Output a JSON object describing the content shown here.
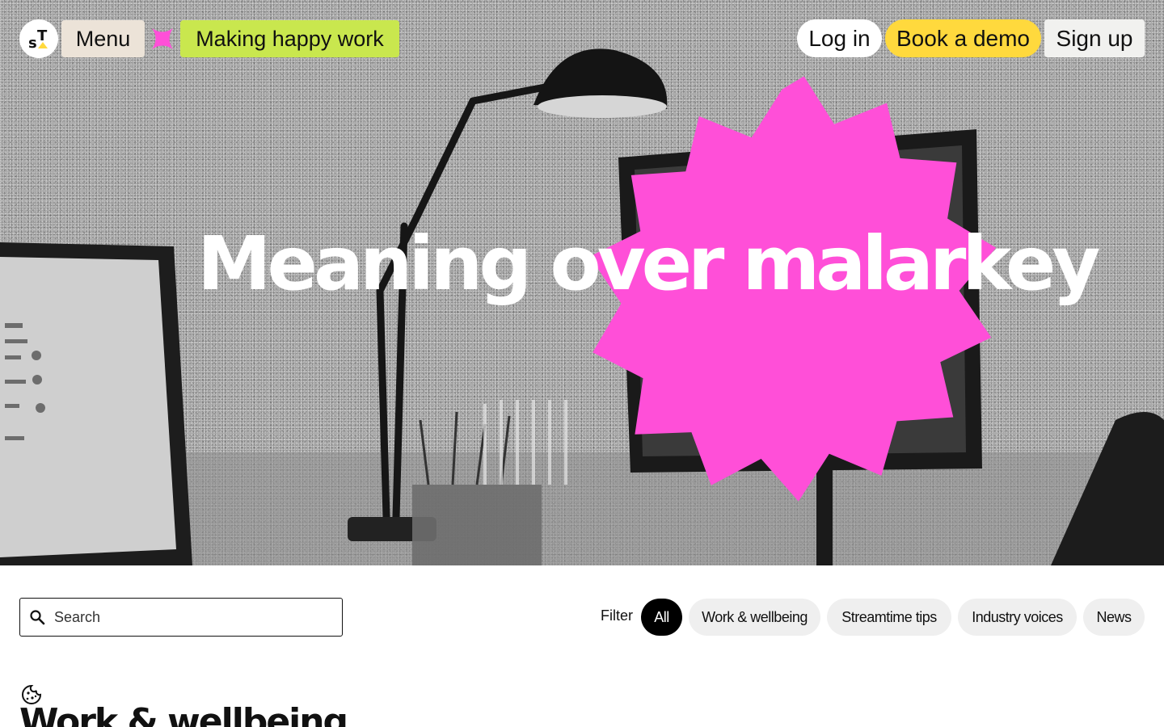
{
  "nav": {
    "menu_label": "Menu",
    "tagline": "Making happy work",
    "login_label": "Log in",
    "demo_label": "Book a demo",
    "signup_label": "Sign up"
  },
  "hero": {
    "headline": "Meaning over malarkey",
    "badge_color": "#ff4fd8"
  },
  "search": {
    "placeholder": "Search"
  },
  "filter": {
    "label": "Filter",
    "options": [
      "All",
      "Work & wellbeing",
      "Streamtime tips",
      "Industry voices",
      "News"
    ],
    "selected": "All"
  },
  "section": {
    "icon": "cookie-icon",
    "title": "Work & wellbeing"
  },
  "colors": {
    "menu_bg": "#ece3d8",
    "tagline_bg": "#c9e74e",
    "demo_bg": "#ffd93d",
    "accent_pink": "#ff4fd8"
  }
}
